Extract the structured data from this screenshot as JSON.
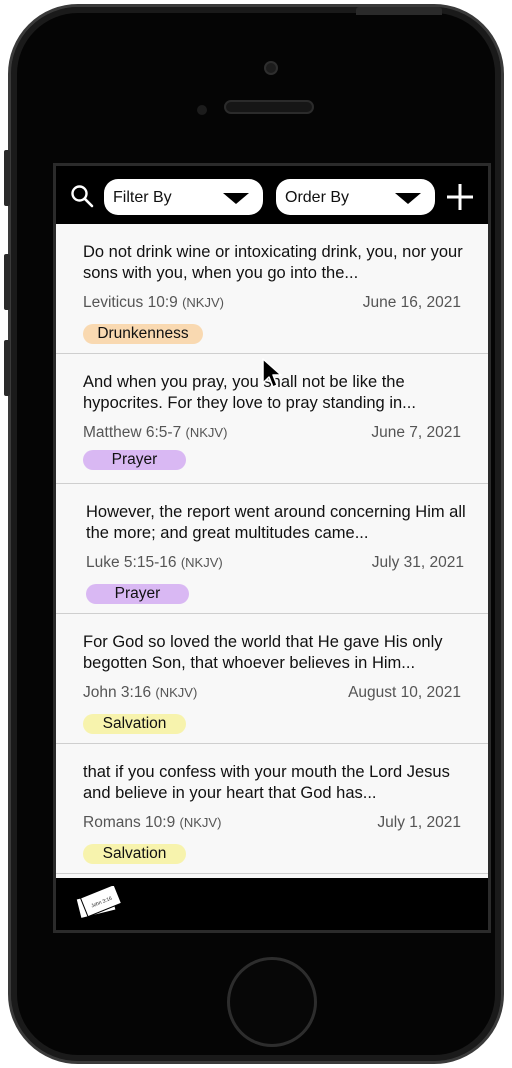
{
  "toolbar": {
    "filter_label": "Filter By",
    "order_label": "Order By",
    "search_icon": "search-icon",
    "add_icon": "plus-icon"
  },
  "cards": [
    {
      "text": "Do not drink wine or intoxicating drink, you, nor your sons with you, when you go into the...",
      "reference": "Leviticus 10:9",
      "version": "(NKJV)",
      "date": "June 16, 2021",
      "tag": "Drunkenness",
      "tag_color": "#f9d9b1"
    },
    {
      "text": "And when you pray, you shall not be like the hypocrites. For they love to pray standing in...",
      "reference": "Matthew 6:5-7",
      "version": "(NKJV)",
      "date": "June 7, 2021",
      "tag": "Prayer",
      "tag_color": "#d9b8f3"
    },
    {
      "text": "However, the report went around concerning Him all the more; and great multitudes came...",
      "reference": "Luke 5:15-16",
      "version": "(NKJV)",
      "date": "July 31, 2021",
      "tag": "Prayer",
      "tag_color": "#d9b8f3"
    },
    {
      "text": "For God so loved the world that He gave His only begotten Son, that whoever believes in Him...",
      "reference": "John 3:16",
      "version": "(NKJV)",
      "date": "August 10, 2021",
      "tag": "Salvation",
      "tag_color": "#f7f3ad"
    },
    {
      "text": "that if you confess with your mouth the Lord Jesus and believe in your heart that God has...",
      "reference": "Romans 10:9",
      "version": "(NKJV)",
      "date": "July 1, 2021",
      "tag": "Salvation",
      "tag_color": "#f7f3ad"
    }
  ],
  "bottom": {
    "logo_text": "John 3:16"
  }
}
